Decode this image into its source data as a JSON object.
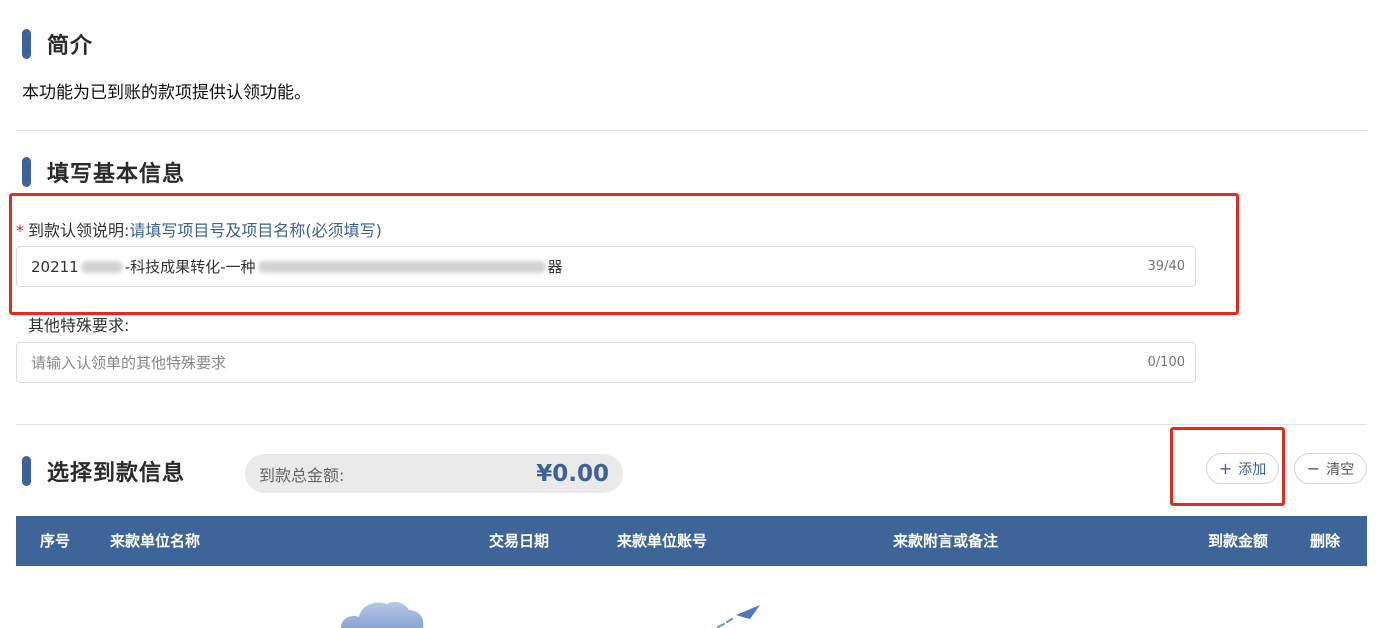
{
  "sections": {
    "intro": {
      "title": "简介",
      "text": "本功能为已到账的款项提供认领功能。"
    },
    "basic_info": {
      "title": "填写基本信息"
    },
    "payments": {
      "title": "选择到款信息"
    }
  },
  "form": {
    "description": {
      "required_mark": "*",
      "label": "到款认领说明:",
      "hint": "请填写项目号及项目名称(必须填写)",
      "value_prefix": "20211",
      "value_middle": "-科技成果转化-一种",
      "value_suffix": "器",
      "counter": "39/40"
    },
    "special": {
      "label": "其他特殊要求:",
      "placeholder": "请输入认领单的其他特殊要求",
      "counter": "0/100"
    }
  },
  "total": {
    "label": "到款总金额:",
    "value": "¥0.00"
  },
  "buttons": {
    "add": {
      "icon": "plus-icon",
      "label": "添加"
    },
    "clear": {
      "icon": "minus-icon",
      "label": "清空"
    }
  },
  "table": {
    "columns": [
      "序号",
      "来款单位名称",
      "交易日期",
      "来款单位账号",
      "来款附言或备注",
      "到款金额",
      "删除"
    ]
  },
  "colors": {
    "accent": "#3d6199",
    "table_header": "#3d6599",
    "highlight": "#e52b20"
  }
}
